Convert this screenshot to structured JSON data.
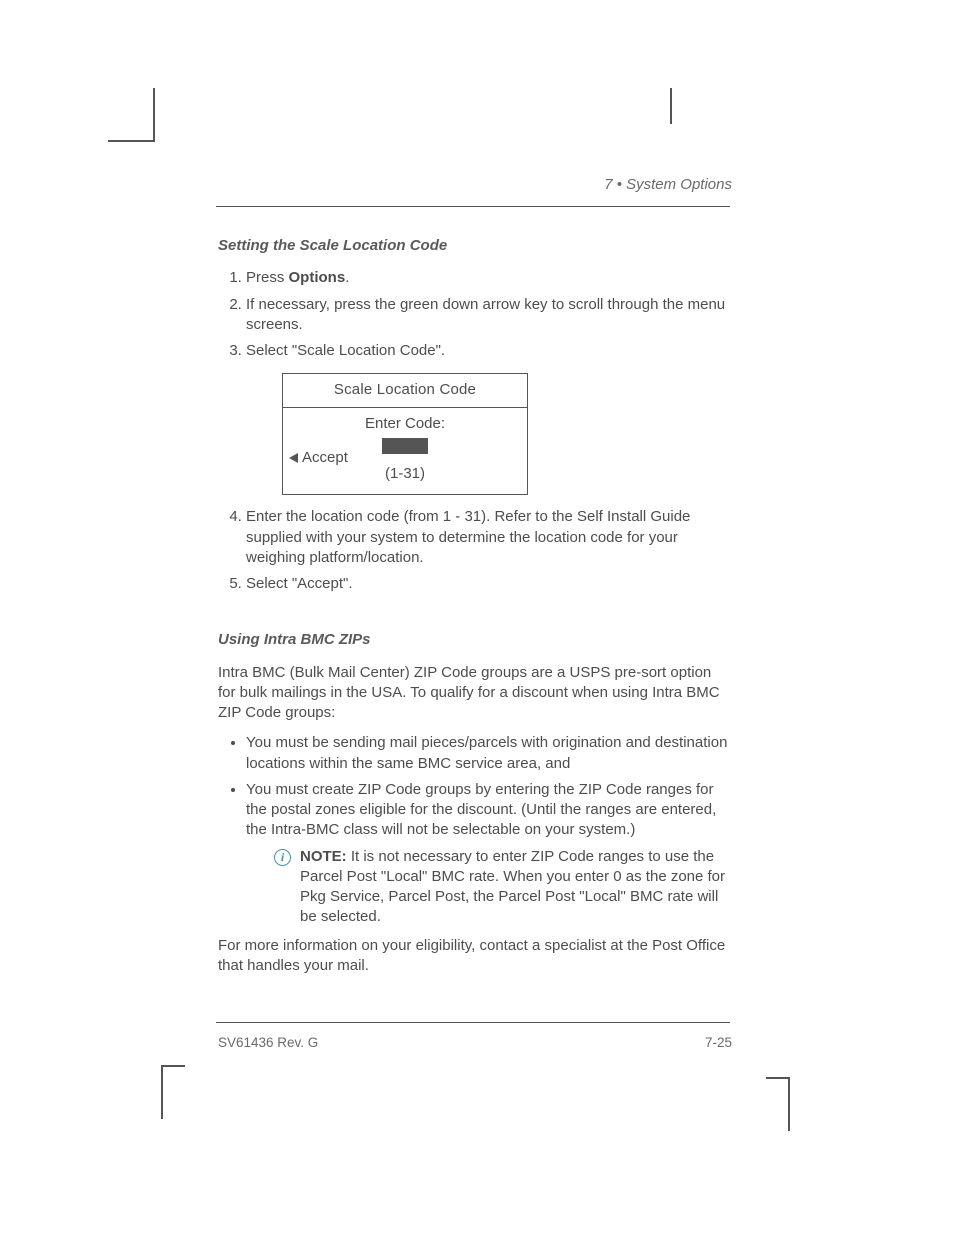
{
  "running_head": "7 • System Options",
  "footer": {
    "left": "SV61436 Rev. G",
    "right": "7-25"
  },
  "section1": {
    "title": "Setting the Scale Location Code",
    "steps": [
      {
        "pre": "Press ",
        "bold": "Options",
        "post": "."
      },
      {
        "text": "If necessary, press the green down arrow key to scroll through the menu screens."
      },
      {
        "text": "Select \"Scale Location Code\"."
      },
      {
        "text": "Enter the location code (from 1 - 31). Refer to the Self Install Guide supplied with your system to determine the location code for your weighing platform/location."
      },
      {
        "text": "Select \"Accept\"."
      }
    ],
    "screen": {
      "title": "Scale Location Code",
      "enter": "Enter Code:",
      "range": "(1-31)",
      "accept": "Accept"
    }
  },
  "section2": {
    "title": "Using Intra BMC ZIPs",
    "intro": "Intra BMC (Bulk Mail Center) ZIP Code groups are a USPS pre-sort option for bulk mailings in the USA. To qualify for a discount when using Intra BMC ZIP Code groups:",
    "bullets": [
      "You must be sending mail pieces/parcels with origination and destination locations within the same BMC service area, and",
      "You must create ZIP Code groups by entering the ZIP Code ranges for the postal zones eligible for the discount. (Until the ranges are entered, the Intra-BMC class will not be selectable on your system.)"
    ],
    "note_label": "NOTE:",
    "note_text": " It is not necessary to enter ZIP Code ranges to use the Parcel Post \"Local\" BMC rate. When you enter 0 as the zone for Pkg Service, Parcel Post, the Parcel Post \"Local\" BMC rate will be selected.",
    "outro": "For more information on your eligibility, contact a specialist at the Post Office that handles your mail."
  }
}
